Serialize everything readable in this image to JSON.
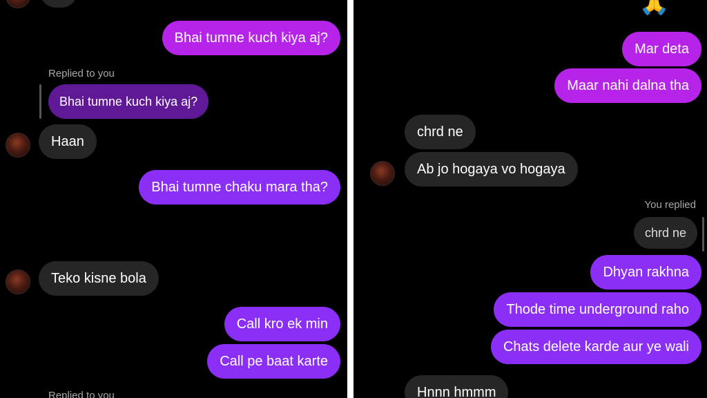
{
  "left": {
    "messages": {
      "m1": "Bhai tumne kuch kiya aj?",
      "reply_label": "Replied to you",
      "quoted": "Bhai tumne kuch kiya aj?",
      "m2": "Haan",
      "m3": "Bhai tumne chaku mara tha?",
      "emoji": "😭",
      "m4": "Teko kisne bola",
      "m5": "Call kro ek min",
      "m6": "Call pe baat karte",
      "reply_label_bottom": "Replied to you"
    }
  },
  "right": {
    "messages": {
      "top_emoji": "🙏😭",
      "m1": "Mar deta",
      "m2": "Maar nahi dalna tha",
      "m3": "chrd ne",
      "m4": "Ab jo hogaya vo hogaya",
      "reply_label": "You replied",
      "quoted": "chrd ne",
      "m5": "Dhyan rakhna",
      "m6": "Thode time underground raho",
      "m7": "Chats delete karde aur ye wali",
      "m8": "Hnnn hmmm"
    }
  },
  "colors": {
    "sent": "#8b2ff6",
    "sent_pink": "#b524e8",
    "received": "#262626",
    "background": "#000000"
  }
}
